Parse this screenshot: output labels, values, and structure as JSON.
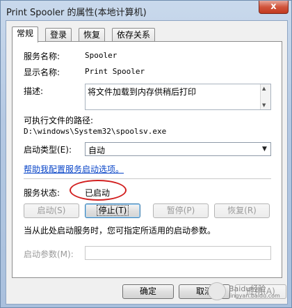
{
  "window": {
    "title": "Print Spooler 的属性(本地计算机)",
    "close_glyph": "x"
  },
  "tabs": [
    {
      "label": "常规",
      "active": true
    },
    {
      "label": "登录",
      "active": false
    },
    {
      "label": "恢复",
      "active": false
    },
    {
      "label": "依存关系",
      "active": false
    }
  ],
  "general": {
    "service_name_label": "服务名称:",
    "service_name": "Spooler",
    "display_name_label": "显示名称:",
    "display_name": "Print Spooler",
    "description_label": "描述:",
    "description": "将文件加载到内存供稍后打印",
    "exe_path_label": "可执行文件的路径:",
    "exe_path": "D:\\windows\\System32\\spoolsv.exe",
    "startup_type_label": "启动类型(E):",
    "startup_type": "自动",
    "help_link": "帮助我配置服务启动选项。",
    "status_label": "服务状态:",
    "status_value": "已启动",
    "start_button": "启动(S)",
    "stop_button": "停止(T)",
    "pause_button": "暂停(P)",
    "resume_button": "恢复(R)",
    "hint": "当从此处启动服务时，您可指定所适用的启动参数。",
    "start_params_label": "启动参数(M):",
    "start_params_value": ""
  },
  "footer": {
    "ok_button": "确定",
    "cancel_button": "取消",
    "apply_button": "应用(A)"
  },
  "watermark": {
    "text": "Baidu经验",
    "domain": "jingyan.baidu.com"
  }
}
